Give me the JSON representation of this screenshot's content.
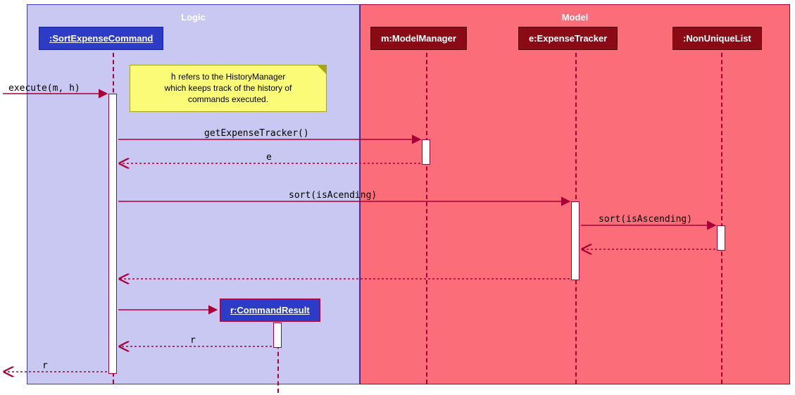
{
  "boxes": {
    "logic": {
      "title": "Logic"
    },
    "model": {
      "title": "Model"
    }
  },
  "participants": {
    "sortCmd": ":SortExpenseCommand",
    "modelMgr": "m:ModelManager",
    "expenseTracker": "e:ExpenseTracker",
    "nonUniqueList": ":NonUniqueList",
    "commandResult": "r:CommandResult"
  },
  "note": {
    "prefix": "h",
    "text1": " refers to the HistoryManager",
    "text2": "which keeps track of the history of",
    "text3": "commands executed."
  },
  "messages": {
    "execute": "execute(m, h)",
    "getExpenseTracker": "getExpenseTracker()",
    "return_e": "e",
    "sort1": "sort(isAcending)",
    "sort2": "sort(isAscending)",
    "return_r1": "r",
    "return_r2": "r"
  },
  "chart_data": {
    "type": "sequence-diagram",
    "boxes": [
      {
        "name": "Logic",
        "participants": [
          ":SortExpenseCommand",
          "r:CommandResult"
        ]
      },
      {
        "name": "Model",
        "participants": [
          "m:ModelManager",
          "e:ExpenseTracker",
          ":NonUniqueList"
        ]
      }
    ],
    "participants": [
      ":SortExpenseCommand",
      "m:ModelManager",
      "e:ExpenseTracker",
      ":NonUniqueList",
      "r:CommandResult"
    ],
    "note": {
      "attached_to": ":SortExpenseCommand",
      "text": "h refers to the HistoryManager which keeps track of the history of commands executed."
    },
    "messages": [
      {
        "from": "caller",
        "to": ":SortExpenseCommand",
        "label": "execute(m, h)",
        "type": "sync"
      },
      {
        "from": ":SortExpenseCommand",
        "to": "m:ModelManager",
        "label": "getExpenseTracker()",
        "type": "sync"
      },
      {
        "from": "m:ModelManager",
        "to": ":SortExpenseCommand",
        "label": "e",
        "type": "return"
      },
      {
        "from": ":SortExpenseCommand",
        "to": "e:ExpenseTracker",
        "label": "sort(isAcending)",
        "type": "sync"
      },
      {
        "from": "e:ExpenseTracker",
        "to": ":NonUniqueList",
        "label": "sort(isAscending)",
        "type": "sync"
      },
      {
        "from": ":NonUniqueList",
        "to": "e:ExpenseTracker",
        "label": "",
        "type": "return"
      },
      {
        "from": "e:ExpenseTracker",
        "to": ":SortExpenseCommand",
        "label": "",
        "type": "return"
      },
      {
        "from": ":SortExpenseCommand",
        "to": "r:CommandResult",
        "label": "",
        "type": "create"
      },
      {
        "from": "r:CommandResult",
        "to": ":SortExpenseCommand",
        "label": "r",
        "type": "return"
      },
      {
        "from": ":SortExpenseCommand",
        "to": "caller",
        "label": "r",
        "type": "return"
      }
    ]
  }
}
